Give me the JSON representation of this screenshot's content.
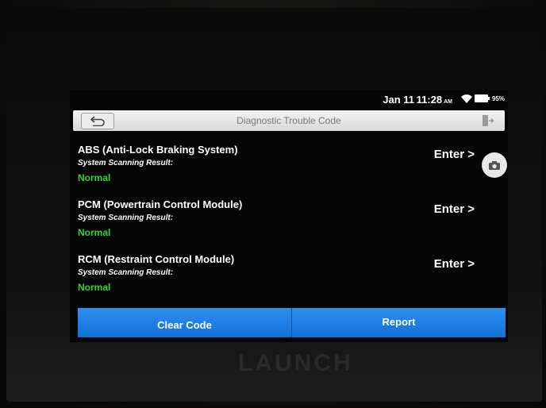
{
  "status_bar": {
    "date": "Jan 11",
    "time": "11:28",
    "ampm": "AM",
    "battery": "95%",
    "icons": [
      "wifi-icon",
      "battery-icon"
    ]
  },
  "header": {
    "title": "Diagnostic Trouble Code",
    "back_icon": "back-arrow-icon",
    "exit_icon": "exit-icon"
  },
  "systems": [
    {
      "name": "ABS (Anti-Lock Braking System)",
      "result_label": "System Scanning Result:",
      "status": "Normal",
      "action": "Enter >"
    },
    {
      "name": "PCM (Powertrain Control Module)",
      "result_label": "System Scanning Result:",
      "status": "Normal",
      "action": "Enter >"
    },
    {
      "name": "RCM (Restraint Control Module)",
      "result_label": "System Scanning Result:",
      "status": "Normal",
      "action": "Enter >"
    }
  ],
  "footer": {
    "clear_code": "Clear Code",
    "report": "Report"
  },
  "device_brand": "LAUNCH",
  "colors": {
    "status_normal": "#35d435",
    "action_bar": "#1f80e8"
  }
}
